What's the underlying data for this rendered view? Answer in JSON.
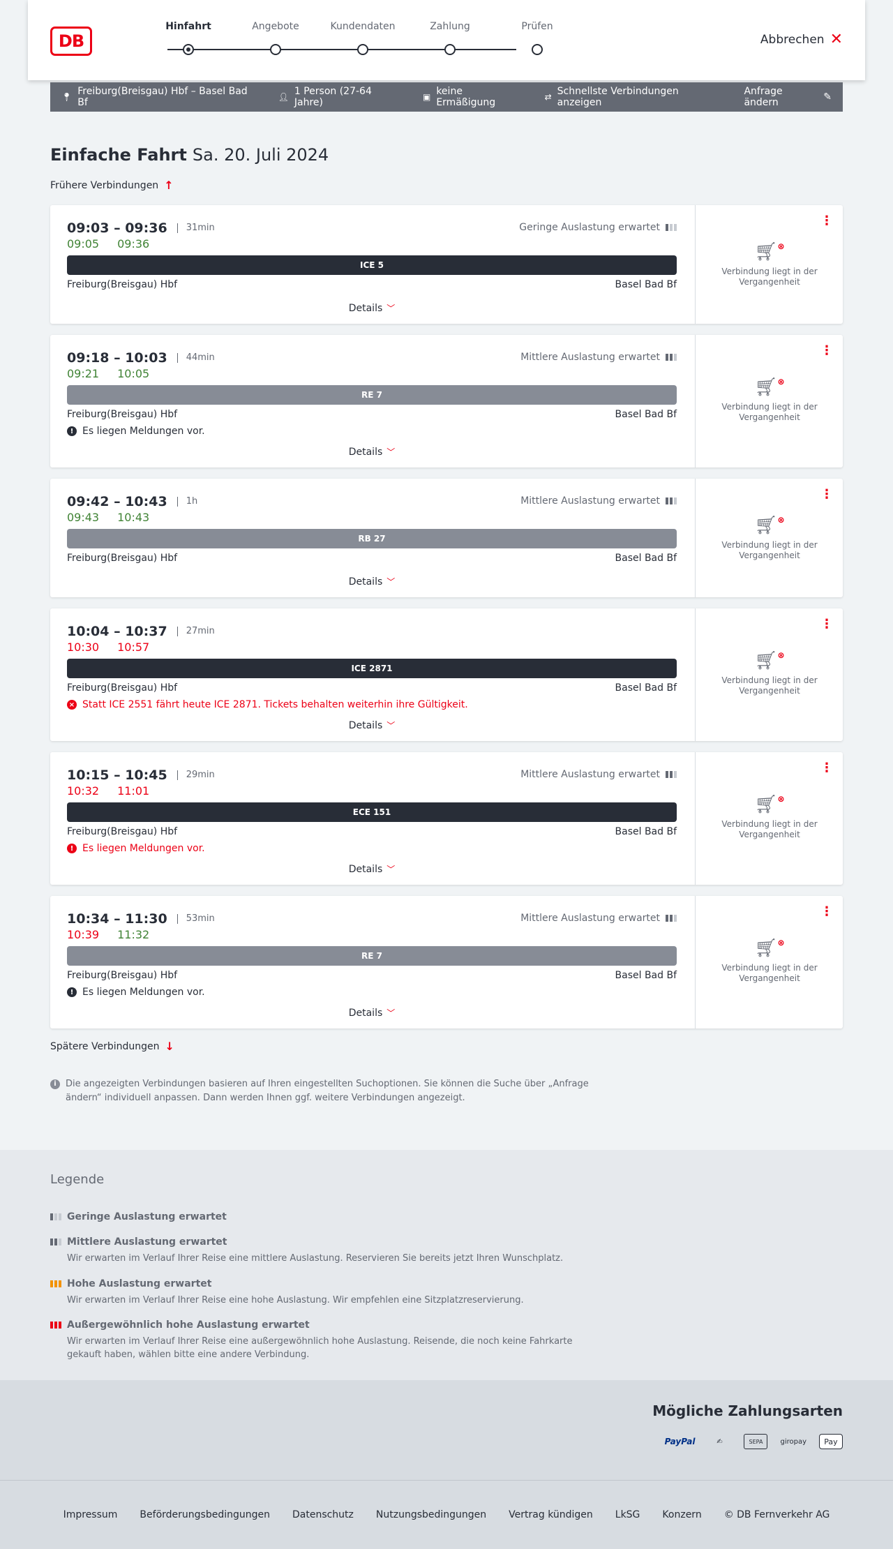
{
  "header": {
    "logo_text": "DB",
    "steps": [
      "Hinfahrt",
      "Angebote",
      "Kundendaten",
      "Zahlung",
      "Prüfen"
    ],
    "active_step": "Hinfahrt",
    "cancel_label": "Abbrechen"
  },
  "summary": {
    "route": "Freiburg(Breisgau) Hbf – Basel Bad Bf",
    "travellers": "1 Person (27-64 Jahre)",
    "discount": "keine Ermäßigung",
    "fastest": "Schnellste Verbindungen anzeigen",
    "change_label": "Anfrage ändern"
  },
  "title": {
    "trip_type": "Einfache Fahrt",
    "date": "Sa. 20. Juli 2024"
  },
  "earlier_label": "Frühere Verbindungen",
  "later_label": "Spätere Verbindungen",
  "details_label": "Details",
  "past_text": "Verbindung liegt in der Vergangenheit",
  "connections": [
    {
      "times": "09:03 – 09:36",
      "duration": "31min",
      "rt_dep": "09:05",
      "rt_arr": "09:36",
      "rt_dep_color": "green",
      "rt_arr_color": "green",
      "load": "Geringe Auslastung erwartet",
      "load_level": 1,
      "train": "ICE 5",
      "train_style": "dark",
      "from": "Freiburg(Breisgau) Hbf",
      "to": "Basel Bad Bf",
      "message": ""
    },
    {
      "times": "09:18 – 10:03",
      "duration": "44min",
      "rt_dep": "09:21",
      "rt_arr": "10:05",
      "rt_dep_color": "green",
      "rt_arr_color": "green",
      "load": "Mittlere Auslastung erwartet",
      "load_level": 2,
      "train": "RE 7",
      "train_style": "grey",
      "from": "Freiburg(Breisgau) Hbf",
      "to": "Basel Bad Bf",
      "message": "Es liegen Meldungen vor.",
      "message_color": "black"
    },
    {
      "times": "09:42 – 10:43",
      "duration": "1h",
      "rt_dep": "09:43",
      "rt_arr": "10:43",
      "rt_dep_color": "green",
      "rt_arr_color": "green",
      "load": "Mittlere Auslastung erwartet",
      "load_level": 2,
      "train": "RB 27",
      "train_style": "grey",
      "from": "Freiburg(Breisgau) Hbf",
      "to": "Basel Bad Bf",
      "message": ""
    },
    {
      "times": "10:04 – 10:37",
      "duration": "27min",
      "rt_dep": "10:30",
      "rt_arr": "10:57",
      "rt_dep_color": "red",
      "rt_arr_color": "red",
      "load": "",
      "load_level": 0,
      "train": "ICE 2871",
      "train_style": "dark",
      "from": "Freiburg(Breisgau) Hbf",
      "to": "Basel Bad Bf",
      "message": "Statt ICE 2551 fährt heute ICE 2871. Tickets behalten weiterhin ihre Gültigkeit.",
      "message_color": "red",
      "message_icon": "x"
    },
    {
      "times": "10:15 – 10:45",
      "duration": "29min",
      "rt_dep": "10:32",
      "rt_arr": "11:01",
      "rt_dep_color": "red",
      "rt_arr_color": "red",
      "load": "Mittlere Auslastung erwartet",
      "load_level": 2,
      "train": "ECE 151",
      "train_style": "dark",
      "from": "Freiburg(Breisgau) Hbf",
      "to": "Basel Bad Bf",
      "message": "Es liegen Meldungen vor.",
      "message_color": "red"
    },
    {
      "times": "10:34 – 11:30",
      "duration": "53min",
      "rt_dep": "10:39",
      "rt_arr": "11:32",
      "rt_dep_color": "red",
      "rt_arr_color": "green",
      "load": "Mittlere Auslastung erwartet",
      "load_level": 2,
      "train": "RE 7",
      "train_style": "grey",
      "from": "Freiburg(Breisgau) Hbf",
      "to": "Basel Bad Bf",
      "message": "Es liegen Meldungen vor.",
      "message_color": "black"
    }
  ],
  "info_text": "Die angezeigten Verbindungen basieren auf Ihren eingestellten Suchoptionen. Sie können die Suche über „Anfrage ändern“ individuell anpassen. Dann werden Ihnen ggf. weitere Verbindungen angezeigt.",
  "legend": {
    "title": "Legende",
    "items": [
      {
        "title": "Geringe Auslastung erwartet",
        "desc": ""
      },
      {
        "title": "Mittlere Auslastung erwartet",
        "desc": "Wir erwarten im Verlauf Ihrer Reise eine mittlere Auslastung. Reservieren Sie bereits jetzt Ihren Wunschplatz."
      },
      {
        "title": "Hohe Auslastung erwartet",
        "desc": "Wir erwarten im Verlauf Ihrer Reise eine hohe Auslastung. Wir empfehlen eine Sitzplatzreservierung."
      },
      {
        "title": "Außergewöhnlich hohe Auslastung erwartet",
        "desc": "Wir erwarten im Verlauf Ihrer Reise eine außergewöhnlich hohe Auslastung. Reisende, die noch keine Fahrkarte gekauft haben, wählen bitte eine andere Verbindung."
      }
    ]
  },
  "payment": {
    "title": "Mögliche Zahlungsarten",
    "methods": [
      "PayPal",
      "card-icon",
      "SEPA",
      "giropay",
      "Pay"
    ]
  },
  "footer": {
    "links": [
      "Impressum",
      "Beförderungsbedingungen",
      "Datenschutz",
      "Nutzungsbedingungen",
      "Vertrag kündigen",
      "LkSG",
      "Konzern",
      "© DB Fernverkehr AG"
    ]
  },
  "colors": {
    "brand_red": "#ec0016",
    "punctual_green": "#408335",
    "dark": "#282d37"
  }
}
